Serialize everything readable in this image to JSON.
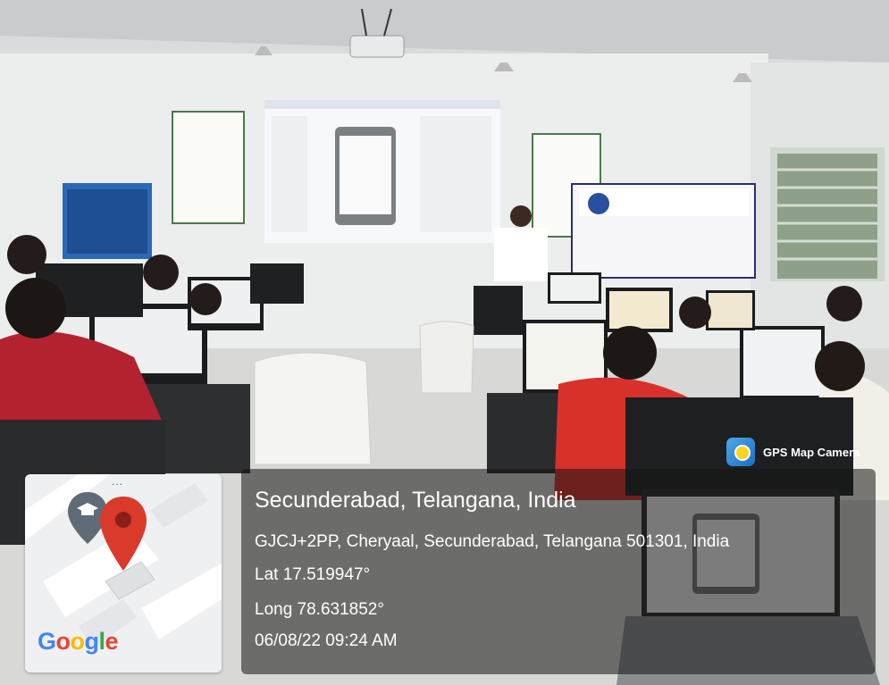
{
  "scene": {
    "description_free": true
  },
  "badge": {
    "label": "GPS Map Camera",
    "icon": "camera-app-icon"
  },
  "location": {
    "place": "Secunderabad, Telangana, India",
    "address": "GJCJ+2PP, Cheryaal, Secunderabad, Telangana 501301, India",
    "lat": "Lat 17.519947°",
    "long": "Long 78.631852°",
    "datetime": "06/08/22 09:24 AM"
  },
  "map": {
    "logo": "Google",
    "menu_dots": "..."
  },
  "colors": {
    "pin_red": "#d93a2b",
    "pin_grey": "#5f6b76"
  }
}
